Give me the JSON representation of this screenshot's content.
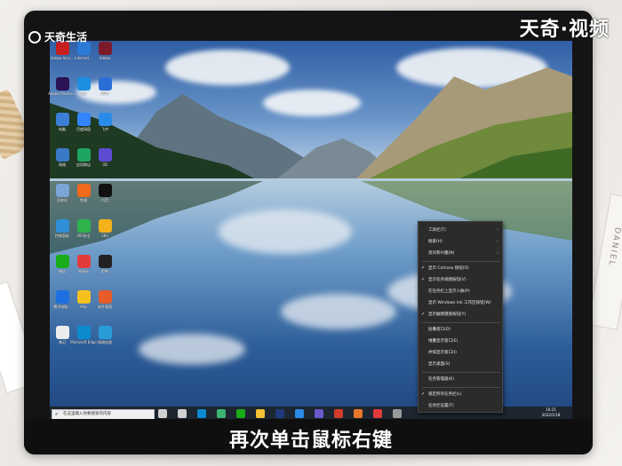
{
  "watermark_left": "天奇生活",
  "watermark_right": "天奇·视频",
  "background_book_text": "DANIEL",
  "caption": "再次单击鼠标右键",
  "desktop_icons": [
    {
      "label": "Adobe Acro...",
      "color": "#c81e1e"
    },
    {
      "label": "Internet...",
      "color": "#2a7ad6"
    },
    {
      "label": "Adobe",
      "color": "#7b1b2a"
    },
    {
      "label": "Adobe Premie...",
      "color": "#2a1255"
    },
    {
      "label": "QQ",
      "color": "#1d8fe0"
    },
    {
      "label": "WPS",
      "color": "#2a6fd6"
    },
    {
      "label": "电脑",
      "color": "#3b7fd8"
    },
    {
      "label": "百度网盘",
      "color": "#3385ff"
    },
    {
      "label": "飞书",
      "color": "#2b8be8"
    },
    {
      "label": "网络",
      "color": "#3a78c8"
    },
    {
      "label": "应用商店",
      "color": "#1fa463"
    },
    {
      "label": "3D",
      "color": "#5b4cd2"
    },
    {
      "label": "回收站",
      "color": "#7aa5d6"
    },
    {
      "label": "剪辑",
      "color": "#f26a1b"
    },
    {
      "label": "抖音",
      "color": "#111111"
    },
    {
      "label": "控制面板",
      "color": "#2f8fd8"
    },
    {
      "label": "360安全",
      "color": "#2fb24c"
    },
    {
      "label": "360",
      "color": "#f3b21a"
    },
    {
      "label": "微信",
      "color": "#1aad19"
    },
    {
      "label": "网易云",
      "color": "#e23b3b"
    },
    {
      "label": "剪映",
      "color": "#222222"
    },
    {
      "label": "腾讯电脑...",
      "color": "#1e6fe0"
    },
    {
      "label": "Xtip",
      "color": "#f5c11d"
    },
    {
      "label": "软件管理",
      "color": "#e65d2b"
    },
    {
      "label": "笔记",
      "color": "#ededed"
    },
    {
      "label": "Microsoft Edge",
      "color": "#0c8bd1"
    },
    {
      "label": "网络加速",
      "color": "#2a9dd8"
    }
  ],
  "context_menu": {
    "items": [
      {
        "label": "工具栏(T)",
        "check": "",
        "submenu": "›"
      },
      {
        "label": "搜索(H)",
        "check": "",
        "submenu": "›"
      },
      {
        "label": "资讯和兴趣(N)",
        "check": "",
        "submenu": "›"
      },
      {
        "label": "显示 Cortana 按钮(O)",
        "check": "✓",
        "submenu": ""
      },
      {
        "label": "显示任务视图按钮(V)",
        "check": "✓",
        "submenu": ""
      },
      {
        "label": "在任务栏上显示人脉(P)",
        "check": "",
        "submenu": ""
      },
      {
        "label": "显示 Windows Ink 工作区按钮(W)",
        "check": "",
        "submenu": ""
      },
      {
        "label": "显示触摸键盘按钮(Y)",
        "check": "✓",
        "submenu": ""
      },
      {
        "label": "层叠窗口(D)",
        "check": "",
        "submenu": ""
      },
      {
        "label": "堆叠显示窗口(E)",
        "check": "",
        "submenu": ""
      },
      {
        "label": "并排显示窗口(I)",
        "check": "",
        "submenu": ""
      },
      {
        "label": "显示桌面(S)",
        "check": "",
        "submenu": ""
      },
      {
        "label": "任务管理器(K)",
        "check": "",
        "submenu": ""
      },
      {
        "label": "锁定所有任务栏(L)",
        "check": "✓",
        "submenu": ""
      },
      {
        "label": "任务栏设置(T)",
        "check": "",
        "submenu": ""
      }
    ]
  },
  "taskbar": {
    "search_placeholder": "在这里输入你要搜索的内容",
    "time": "10:21",
    "date": "2022/1/18"
  },
  "taskbar_icons": [
    {
      "name": "cortana-icon",
      "color": "#d0d0d0"
    },
    {
      "name": "task-view-icon",
      "color": "#d0d0d0"
    },
    {
      "name": "edge-icon",
      "color": "#0c8bd1"
    },
    {
      "name": "browser-icon",
      "color": "#3cb371"
    },
    {
      "name": "wechat-icon",
      "color": "#1aad19"
    },
    {
      "name": "file-explorer-icon",
      "color": "#f1c232"
    },
    {
      "name": "photoshop-icon",
      "color": "#1f3b7a"
    },
    {
      "name": "app-icon",
      "color": "#2b8be8"
    },
    {
      "name": "store-icon",
      "color": "#6a5acd"
    },
    {
      "name": "wps-icon",
      "color": "#d23c2a"
    },
    {
      "name": "office-icon",
      "color": "#e8762b"
    },
    {
      "name": "music-icon",
      "color": "#e23b3b"
    },
    {
      "name": "settings-icon",
      "color": "#999999"
    }
  ]
}
